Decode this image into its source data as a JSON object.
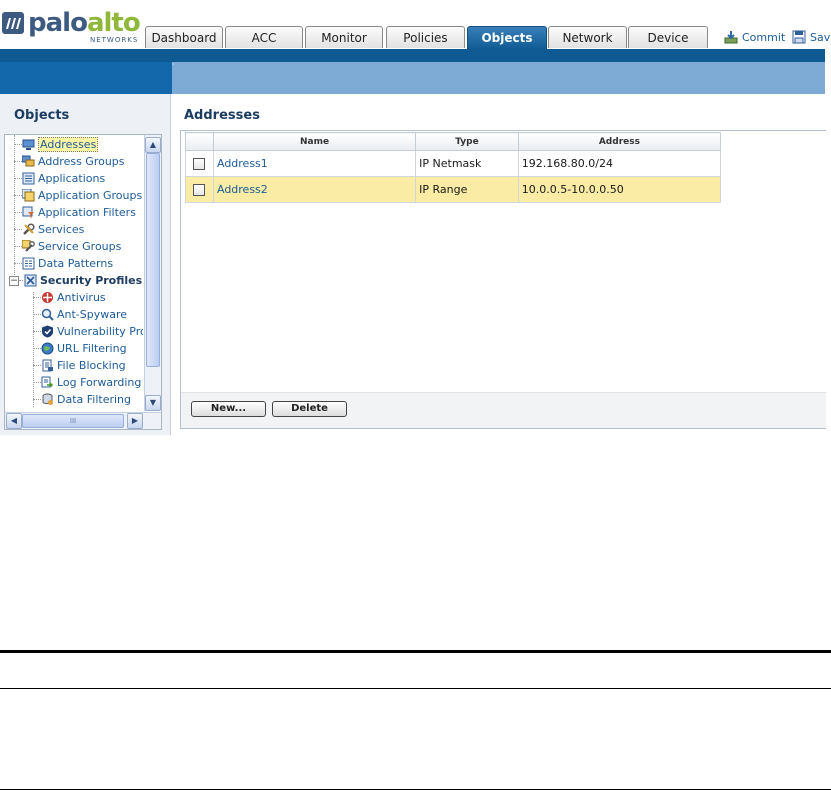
{
  "brand": {
    "name_part1": "palo",
    "name_part2": "alto",
    "sub": "NETWORKS"
  },
  "tabs": [
    {
      "label": "Dashboard"
    },
    {
      "label": "ACC"
    },
    {
      "label": "Monitor"
    },
    {
      "label": "Policies"
    },
    {
      "label": "Objects",
      "active": true
    },
    {
      "label": "Network"
    },
    {
      "label": "Device"
    }
  ],
  "actions": {
    "commit": "Commit",
    "save": "Sav"
  },
  "sidebar": {
    "title": "Objects",
    "items": [
      {
        "label": "Addresses"
      },
      {
        "label": "Address Groups"
      },
      {
        "label": "Applications"
      },
      {
        "label": "Application Groups"
      },
      {
        "label": "Application Filters"
      },
      {
        "label": "Services"
      },
      {
        "label": "Service Groups"
      },
      {
        "label": "Data Patterns"
      },
      {
        "label": "Security Profiles"
      },
      {
        "label": "Antivirus"
      },
      {
        "label": "Ant-Spyware"
      },
      {
        "label": "Vulnerability Prote"
      },
      {
        "label": "URL Filtering"
      },
      {
        "label": "File Blocking"
      },
      {
        "label": "Log Forwarding"
      },
      {
        "label": "Data Filtering"
      }
    ],
    "scroll_glyph": "III"
  },
  "main": {
    "title": "Addresses",
    "columns": {
      "name": "Name",
      "type": "Type",
      "address": "Address"
    },
    "rows": [
      {
        "name": "Address1",
        "type": "IP Netmask",
        "address": "192.168.80.0/24"
      },
      {
        "name": "Address2",
        "type": "IP Range",
        "address": "10.0.0.5-10.0.0.50"
      }
    ],
    "buttons": {
      "new": "New...",
      "delete": "Delete"
    }
  },
  "colors": {
    "accent_dark": "#0f5a93",
    "accent_light": "#7eaad6",
    "link": "#1d5c99",
    "row_highlight": "#faeba5",
    "logo_green": "#8fb83a"
  }
}
